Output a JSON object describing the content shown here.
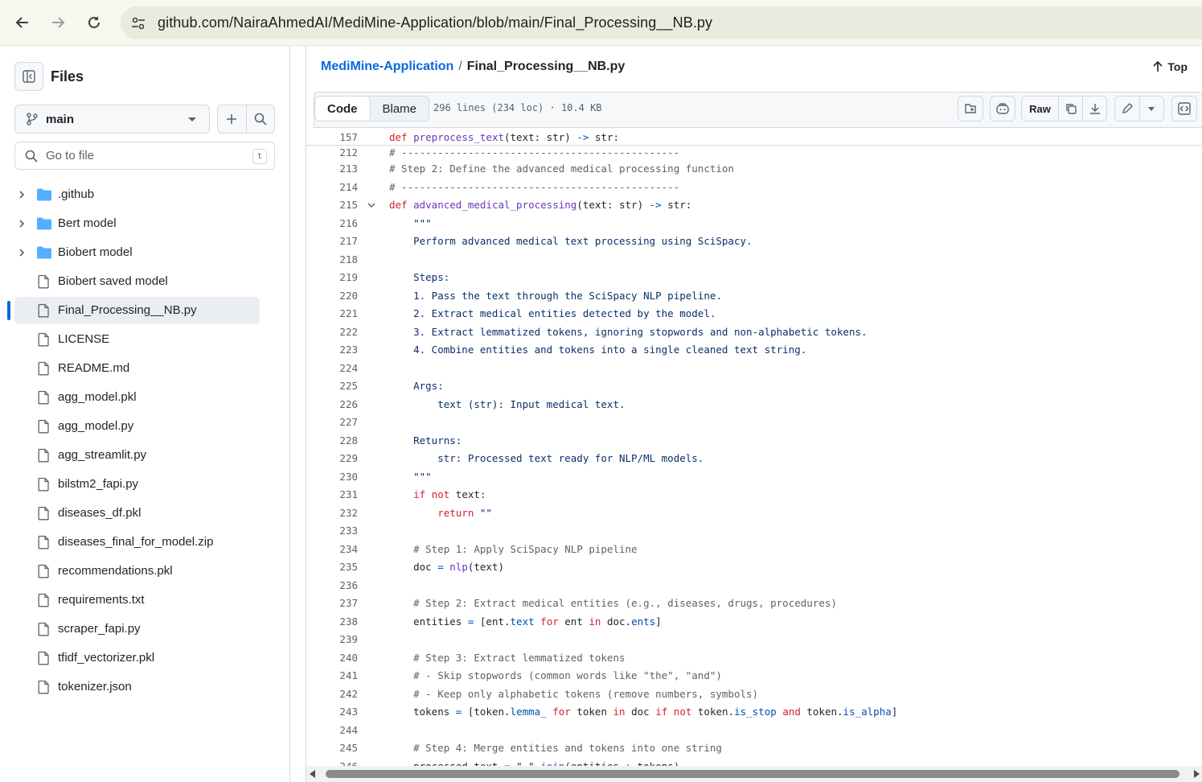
{
  "browser": {
    "url": "github.com/NairaAhmedAI/MediMine-Application/blob/main/Final_Processing__NB.py"
  },
  "sidebar": {
    "title": "Files",
    "branch": "main",
    "search_placeholder": "Go to file",
    "search_shortcut": "t",
    "tree": [
      {
        "name": ".github",
        "type": "folder"
      },
      {
        "name": "Bert model",
        "type": "folder"
      },
      {
        "name": "Biobert model",
        "type": "folder"
      },
      {
        "name": "Biobert saved model",
        "type": "file"
      },
      {
        "name": "Final_Processing__NB.py",
        "type": "file",
        "selected": true
      },
      {
        "name": "LICENSE",
        "type": "file"
      },
      {
        "name": "README.md",
        "type": "file"
      },
      {
        "name": "agg_model.pkl",
        "type": "file"
      },
      {
        "name": "agg_model.py",
        "type": "file"
      },
      {
        "name": "agg_streamlit.py",
        "type": "file"
      },
      {
        "name": "bilstm2_fapi.py",
        "type": "file"
      },
      {
        "name": "diseases_df.pkl",
        "type": "file"
      },
      {
        "name": "diseases_final_for_model.zip",
        "type": "file"
      },
      {
        "name": "recommendations.pkl",
        "type": "file"
      },
      {
        "name": "requirements.txt",
        "type": "file"
      },
      {
        "name": "scraper_fapi.py",
        "type": "file"
      },
      {
        "name": "tfidf_vectorizer.pkl",
        "type": "file"
      },
      {
        "name": "tokenizer.json",
        "type": "file"
      }
    ]
  },
  "breadcrumb": {
    "repo": "MediMine-Application",
    "separator": "/",
    "file": "Final_Processing__NB.py"
  },
  "top_label": "Top",
  "file_header": {
    "code_tab": "Code",
    "blame_tab": "Blame",
    "meta": "296 lines (234 loc) · 10.4 KB",
    "raw_label": "Raw"
  },
  "sticky_line": {
    "number": "157",
    "tokens": [
      [
        "kw",
        "def "
      ],
      [
        "fn",
        "preprocess_text"
      ],
      [
        "",
        "(text: str) "
      ],
      [
        "op",
        "->"
      ],
      [
        "",
        " str:"
      ]
    ]
  },
  "code_lines": [
    {
      "n": "212",
      "tokens": [
        [
          "cm",
          "# ----------------------------------------------"
        ]
      ]
    },
    {
      "n": "213",
      "tokens": [
        [
          "cm",
          "# Step 2: Define the advanced medical processing function"
        ]
      ]
    },
    {
      "n": "214",
      "tokens": [
        [
          "cm",
          "# ----------------------------------------------"
        ]
      ]
    },
    {
      "n": "215",
      "fold": true,
      "tokens": [
        [
          "kw",
          "def "
        ],
        [
          "fn",
          "advanced_medical_processing"
        ],
        [
          "",
          "(text: str) "
        ],
        [
          "op",
          "->"
        ],
        [
          "",
          " str:"
        ]
      ]
    },
    {
      "n": "216",
      "tokens": [
        [
          "st",
          "    \"\"\""
        ]
      ]
    },
    {
      "n": "217",
      "tokens": [
        [
          "st",
          "    Perform advanced medical text processing using SciSpacy."
        ]
      ]
    },
    {
      "n": "218",
      "tokens": [
        [
          "",
          ""
        ]
      ]
    },
    {
      "n": "219",
      "tokens": [
        [
          "st",
          "    Steps:"
        ]
      ]
    },
    {
      "n": "220",
      "tokens": [
        [
          "st",
          "    1. Pass the text through the SciSpacy NLP pipeline."
        ]
      ]
    },
    {
      "n": "221",
      "tokens": [
        [
          "st",
          "    2. Extract medical entities detected by the model."
        ]
      ]
    },
    {
      "n": "222",
      "tokens": [
        [
          "st",
          "    3. Extract lemmatized tokens, ignoring stopwords and non-alphabetic tokens."
        ]
      ]
    },
    {
      "n": "223",
      "tokens": [
        [
          "st",
          "    4. Combine entities and tokens into a single cleaned text string."
        ]
      ]
    },
    {
      "n": "224",
      "tokens": [
        [
          "",
          ""
        ]
      ]
    },
    {
      "n": "225",
      "tokens": [
        [
          "st",
          "    Args:"
        ]
      ]
    },
    {
      "n": "226",
      "tokens": [
        [
          "st",
          "        text (str): Input medical text."
        ]
      ]
    },
    {
      "n": "227",
      "tokens": [
        [
          "",
          ""
        ]
      ]
    },
    {
      "n": "228",
      "tokens": [
        [
          "st",
          "    Returns:"
        ]
      ]
    },
    {
      "n": "229",
      "tokens": [
        [
          "st",
          "        str: Processed text ready for NLP/ML models."
        ]
      ]
    },
    {
      "n": "230",
      "tokens": [
        [
          "st",
          "    \"\"\""
        ]
      ]
    },
    {
      "n": "231",
      "tokens": [
        [
          "kw",
          "    if "
        ],
        [
          "kw",
          "not"
        ],
        [
          "",
          " text:"
        ]
      ]
    },
    {
      "n": "232",
      "tokens": [
        [
          "kw",
          "        return "
        ],
        [
          "st",
          "\"\""
        ]
      ]
    },
    {
      "n": "233",
      "tokens": [
        [
          "",
          ""
        ]
      ]
    },
    {
      "n": "234",
      "tokens": [
        [
          "cm",
          "    # Step 1: Apply SciSpacy NLP pipeline"
        ]
      ]
    },
    {
      "n": "235",
      "tokens": [
        [
          "",
          "    doc "
        ],
        [
          "op",
          "="
        ],
        [
          "",
          " "
        ],
        [
          "fn",
          "nlp"
        ],
        [
          "",
          "(text)"
        ]
      ]
    },
    {
      "n": "236",
      "tokens": [
        [
          "",
          ""
        ]
      ]
    },
    {
      "n": "237",
      "tokens": [
        [
          "cm",
          "    # Step 2: Extract medical entities (e.g., diseases, drugs, procedures)"
        ]
      ]
    },
    {
      "n": "238",
      "tokens": [
        [
          "",
          "    entities "
        ],
        [
          "op",
          "="
        ],
        [
          "",
          " [ent."
        ],
        [
          "op",
          "text"
        ],
        [
          "",
          " "
        ],
        [
          "kw",
          "for"
        ],
        [
          "",
          " ent "
        ],
        [
          "kw",
          "in"
        ],
        [
          "",
          " doc."
        ],
        [
          "op",
          "ents"
        ],
        [
          "",
          "]"
        ]
      ]
    },
    {
      "n": "239",
      "tokens": [
        [
          "",
          ""
        ]
      ]
    },
    {
      "n": "240",
      "tokens": [
        [
          "cm",
          "    # Step 3: Extract lemmatized tokens"
        ]
      ]
    },
    {
      "n": "241",
      "tokens": [
        [
          "cm",
          "    # - Skip stopwords (common words like \"the\", \"and\")"
        ]
      ]
    },
    {
      "n": "242",
      "tokens": [
        [
          "cm",
          "    # - Keep only alphabetic tokens (remove numbers, symbols)"
        ]
      ]
    },
    {
      "n": "243",
      "tokens": [
        [
          "",
          "    tokens "
        ],
        [
          "op",
          "="
        ],
        [
          "",
          " [token."
        ],
        [
          "op",
          "lemma_"
        ],
        [
          "",
          " "
        ],
        [
          "kw",
          "for"
        ],
        [
          "",
          " token "
        ],
        [
          "kw",
          "in"
        ],
        [
          "",
          " doc "
        ],
        [
          "kw",
          "if"
        ],
        [
          "",
          " "
        ],
        [
          "kw",
          "not"
        ],
        [
          "",
          " token."
        ],
        [
          "op",
          "is_stop"
        ],
        [
          "",
          " "
        ],
        [
          "kw",
          "and"
        ],
        [
          "",
          " token."
        ],
        [
          "op",
          "is_alpha"
        ],
        [
          "",
          "]"
        ]
      ]
    },
    {
      "n": "244",
      "tokens": [
        [
          "",
          ""
        ]
      ]
    },
    {
      "n": "245",
      "tokens": [
        [
          "cm",
          "    # Step 4: Merge entities and tokens into one string"
        ]
      ]
    },
    {
      "n": "246",
      "tokens": [
        [
          "",
          "    processed_text "
        ],
        [
          "op",
          "="
        ],
        [
          "",
          " "
        ],
        [
          "st",
          "\" \""
        ],
        [
          "",
          "."
        ],
        [
          "fn",
          "join"
        ],
        [
          "",
          "(entities "
        ],
        [
          "op",
          "+"
        ],
        [
          "",
          " tokens)"
        ]
      ]
    }
  ]
}
